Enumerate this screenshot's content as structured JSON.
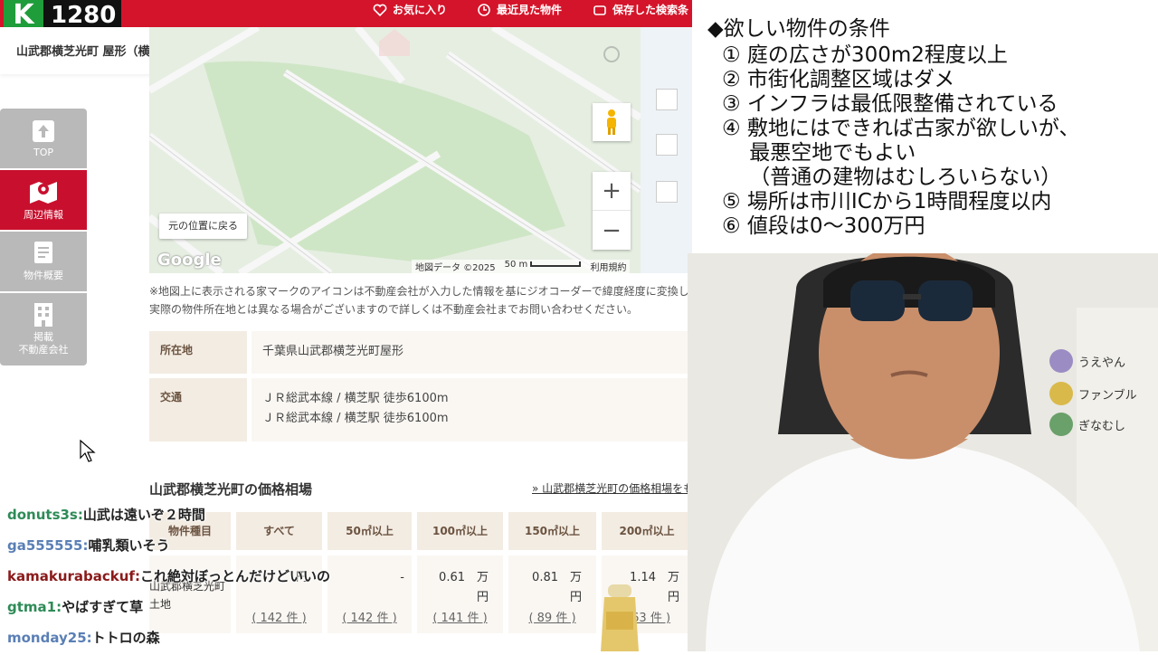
{
  "stream": {
    "viewer_count": "1280",
    "logo": "K"
  },
  "top_nav": {
    "favorites": "お気に入り",
    "recent": "最近見た物件",
    "saved_search": "保存した検索条"
  },
  "page": {
    "title": "山武郡横芝光町 屋形（横芝駅） 住宅用地"
  },
  "sidebar": [
    {
      "label": "TOP",
      "icon": "arrow-up-icon"
    },
    {
      "label": "周辺情報",
      "icon": "map-pin-icon"
    },
    {
      "label": "物件概要",
      "icon": "document-icon"
    },
    {
      "label": "掲載\n不動産会社",
      "icon": "building-icon"
    }
  ],
  "map": {
    "reset_label": "元の位置に戻る",
    "google": "Google",
    "map_data": "地図データ ©2025",
    "scale": "50 m",
    "terms": "利用規約",
    "zoom_in": "+",
    "zoom_out": "−"
  },
  "note": "※地図上に表示される家マークのアイコンは不動産会社が入力した情報を基にジオコーダーで緯度経度に変換し表示しております。実際の物件所在地とは異なる場合がございますので詳しくは不動産会社までお問い合わせください。",
  "info": {
    "address_label": "所在地",
    "address_value": "千葉県山武郡横芝光町屋形",
    "transit_label": "交通",
    "transit_line1": "ＪＲ総武本線 / 横芝駅 徒歩6100m",
    "transit_line2": "ＪＲ総武本線 / 横芝駅 徒歩6100m"
  },
  "price_section": {
    "title": "山武郡横芝光町の価格相場",
    "link": "» 山武郡横芝光町の価格相場をもっ",
    "headers": [
      "物件種目",
      "すべて",
      "50㎡以上",
      "100㎡以上",
      "150㎡以上",
      "200㎡以上"
    ],
    "row_label": "山武郡横芝光町 土地",
    "cells": [
      {
        "value": "",
        "unit": "円",
        "count": "( 142 件 )"
      },
      {
        "value": "-",
        "unit": "",
        "count": "( 142 件 )"
      },
      {
        "value": "0.61　万",
        "unit": "円",
        "count": "( 141 件 )"
      },
      {
        "value": "0.81　万",
        "unit": "円",
        "count": "( 89 件 )"
      },
      {
        "value": "1.14　万",
        "unit": "円",
        "count": "( 63 件 )"
      }
    ]
  },
  "conditions": {
    "title": "◆欲しい物件の条件",
    "items": [
      "① 庭の広さが300m2程度以上",
      "② 市街化調整区域はダメ",
      "③ インフラは最低限整備されている",
      "④ 敷地にはできれば古家が欲しいが、",
      "　 最悪空地でもよい",
      "　 （普通の建物はむしろいらない）",
      "⑤ 場所は市川ICから1時間程度以内",
      "⑥ 値段は0～300万円"
    ]
  },
  "side_chat": [
    "うえやん",
    "ファンブル",
    "ぎなむし"
  ],
  "chat": [
    {
      "user": "donuts3s:",
      "message": "山武は遠いぞ２時間",
      "color": "#2e8b57"
    },
    {
      "user": "ga555555:",
      "message": "哺乳類いそう",
      "color": "#5a7fb5"
    },
    {
      "user": "kamakurabackuf:",
      "message": "これ絶対ぼっとんだけどいいの",
      "color": "#8b1a1a"
    },
    {
      "user": "gtma1:",
      "message": "やばすぎて草",
      "color": "#2e8b57"
    },
    {
      "user": "monday25:",
      "message": "トトロの森",
      "color": "#5a7fb5"
    }
  ]
}
